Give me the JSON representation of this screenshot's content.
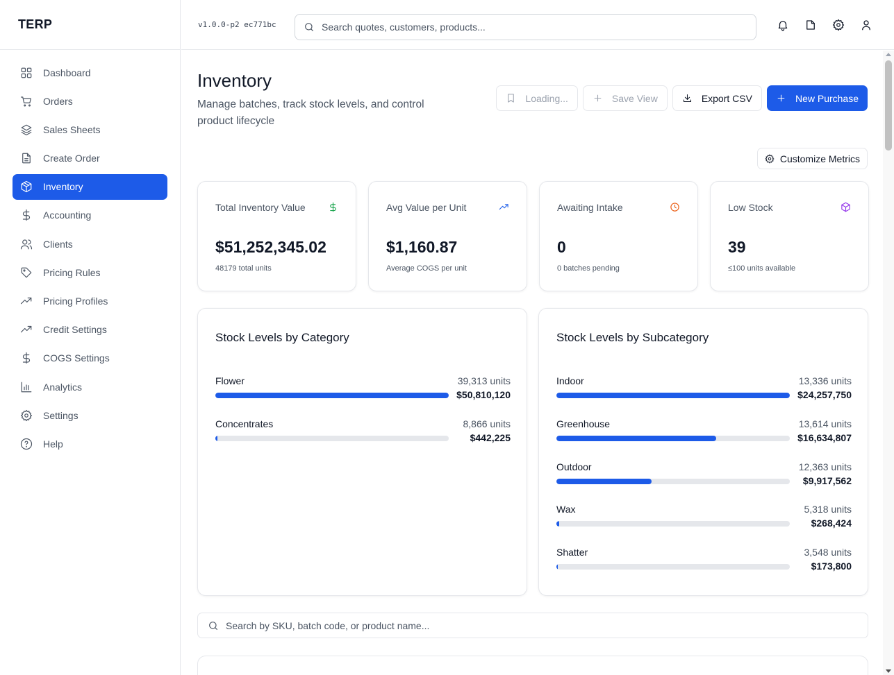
{
  "app": {
    "brand": "TERP",
    "version": "v1.0.0-p2 ec771bc"
  },
  "topbar": {
    "search_placeholder": "Search quotes, customers, products...",
    "icons": [
      "bell-icon",
      "document-icon",
      "settings-icon",
      "user-icon"
    ]
  },
  "sidebar": {
    "items": [
      {
        "label": "Dashboard",
        "icon": "dashboard-icon",
        "active": false
      },
      {
        "label": "Orders",
        "icon": "cart-icon",
        "active": false
      },
      {
        "label": "Sales Sheets",
        "icon": "layers-icon",
        "active": false
      },
      {
        "label": "Create Order",
        "icon": "file-text-icon",
        "active": false
      },
      {
        "label": "Inventory",
        "icon": "package-icon",
        "active": true
      },
      {
        "label": "Accounting",
        "icon": "dollar-icon",
        "active": false
      },
      {
        "label": "Clients",
        "icon": "users-icon",
        "active": false
      },
      {
        "label": "Pricing Rules",
        "icon": "tag-icon",
        "active": false
      },
      {
        "label": "Pricing Profiles",
        "icon": "trending-icon",
        "active": false
      },
      {
        "label": "Credit Settings",
        "icon": "trending-icon",
        "active": false
      },
      {
        "label": "COGS Settings",
        "icon": "dollar-icon",
        "active": false
      },
      {
        "label": "Analytics",
        "icon": "bar-chart-icon",
        "active": false
      },
      {
        "label": "Settings",
        "icon": "settings-icon",
        "active": false
      },
      {
        "label": "Help",
        "icon": "help-icon",
        "active": false
      }
    ]
  },
  "page": {
    "title": "Inventory",
    "subtitle": "Manage batches, track stock levels, and control product lifecycle"
  },
  "actions": {
    "loading_label": "Loading...",
    "save_view_label": "Save View",
    "export_label": "Export CSV",
    "new_purchase_label": "New Purchase",
    "customize_label": "Customize Metrics"
  },
  "metrics": [
    {
      "label": "Total Inventory Value",
      "value": "$51,252,345.02",
      "sub": "48179 total units",
      "icon": "dollar-icon",
      "color": "#16a34a"
    },
    {
      "label": "Avg Value per Unit",
      "value": "$1,160.87",
      "sub": "Average COGS per unit",
      "icon": "trending-up-icon",
      "color": "#2563eb"
    },
    {
      "label": "Awaiting Intake",
      "value": "0",
      "sub": "0 batches pending",
      "icon": "clock-icon",
      "color": "#ea580c"
    },
    {
      "label": "Low Stock",
      "value": "39",
      "sub": "≤100 units available",
      "icon": "package-icon",
      "color": "#9333ea"
    }
  ],
  "category_panel": {
    "title": "Stock Levels by Category",
    "rows": [
      {
        "name": "Flower",
        "units": "39,313 units",
        "value": "$50,810,120",
        "fill_pct": 100
      },
      {
        "name": "Concentrates",
        "units": "8,866 units",
        "value": "$442,225",
        "fill_pct": 0.9
      }
    ]
  },
  "subcategory_panel": {
    "title": "Stock Levels by Subcategory",
    "rows": [
      {
        "name": "Indoor",
        "units": "13,336 units",
        "value": "$24,257,750",
        "fill_pct": 100
      },
      {
        "name": "Greenhouse",
        "units": "13,614 units",
        "value": "$16,634,807",
        "fill_pct": 68.6
      },
      {
        "name": "Outdoor",
        "units": "12,363 units",
        "value": "$9,917,562",
        "fill_pct": 40.9
      },
      {
        "name": "Wax",
        "units": "5,318 units",
        "value": "$268,424",
        "fill_pct": 1.1
      },
      {
        "name": "Shatter",
        "units": "3,548 units",
        "value": "$173,800",
        "fill_pct": 0.7
      }
    ]
  },
  "main_search": {
    "placeholder": "Search by SKU, batch code, or product name..."
  },
  "colors": {
    "accent": "#1d5be8",
    "track": "#e5e7eb"
  }
}
